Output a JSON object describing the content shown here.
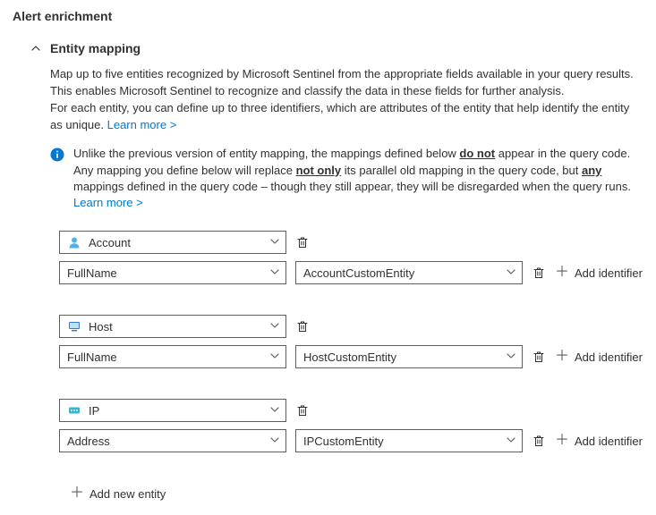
{
  "page_title": "Alert enrichment",
  "section": {
    "title": "Entity mapping",
    "description_1": "Map up to five entities recognized by Microsoft Sentinel from the appropriate fields available in your query results. This enables Microsoft Sentinel to recognize and classify the data in these fields for further analysis.",
    "description_2a": "For each entity, you can define up to three identifiers, which are attributes of the entity that help identify the entity as unique. ",
    "learn_more": "Learn more >",
    "info_pre": "Unlike the previous version of entity mapping, the mappings defined below ",
    "info_bold1": "do not",
    "info_mid": " appear in the query code. Any mapping you define below will replace ",
    "info_bold2": "not only",
    "info_mid2": " its parallel old mapping in the query code, but ",
    "info_bold3": "any",
    "info_post": " mappings defined in the query code – though they still appear, they will be disregarded when the query runs. ",
    "info_learn_more": "Learn more >"
  },
  "mappings": [
    {
      "entity": "Account",
      "identifier": "FullName",
      "value": "AccountCustomEntity"
    },
    {
      "entity": "Host",
      "identifier": "FullName",
      "value": "HostCustomEntity"
    },
    {
      "entity": "IP",
      "identifier": "Address",
      "value": "IPCustomEntity"
    }
  ],
  "add_identifier_label": "Add identifier",
  "add_new_entity_label": "Add new entity"
}
